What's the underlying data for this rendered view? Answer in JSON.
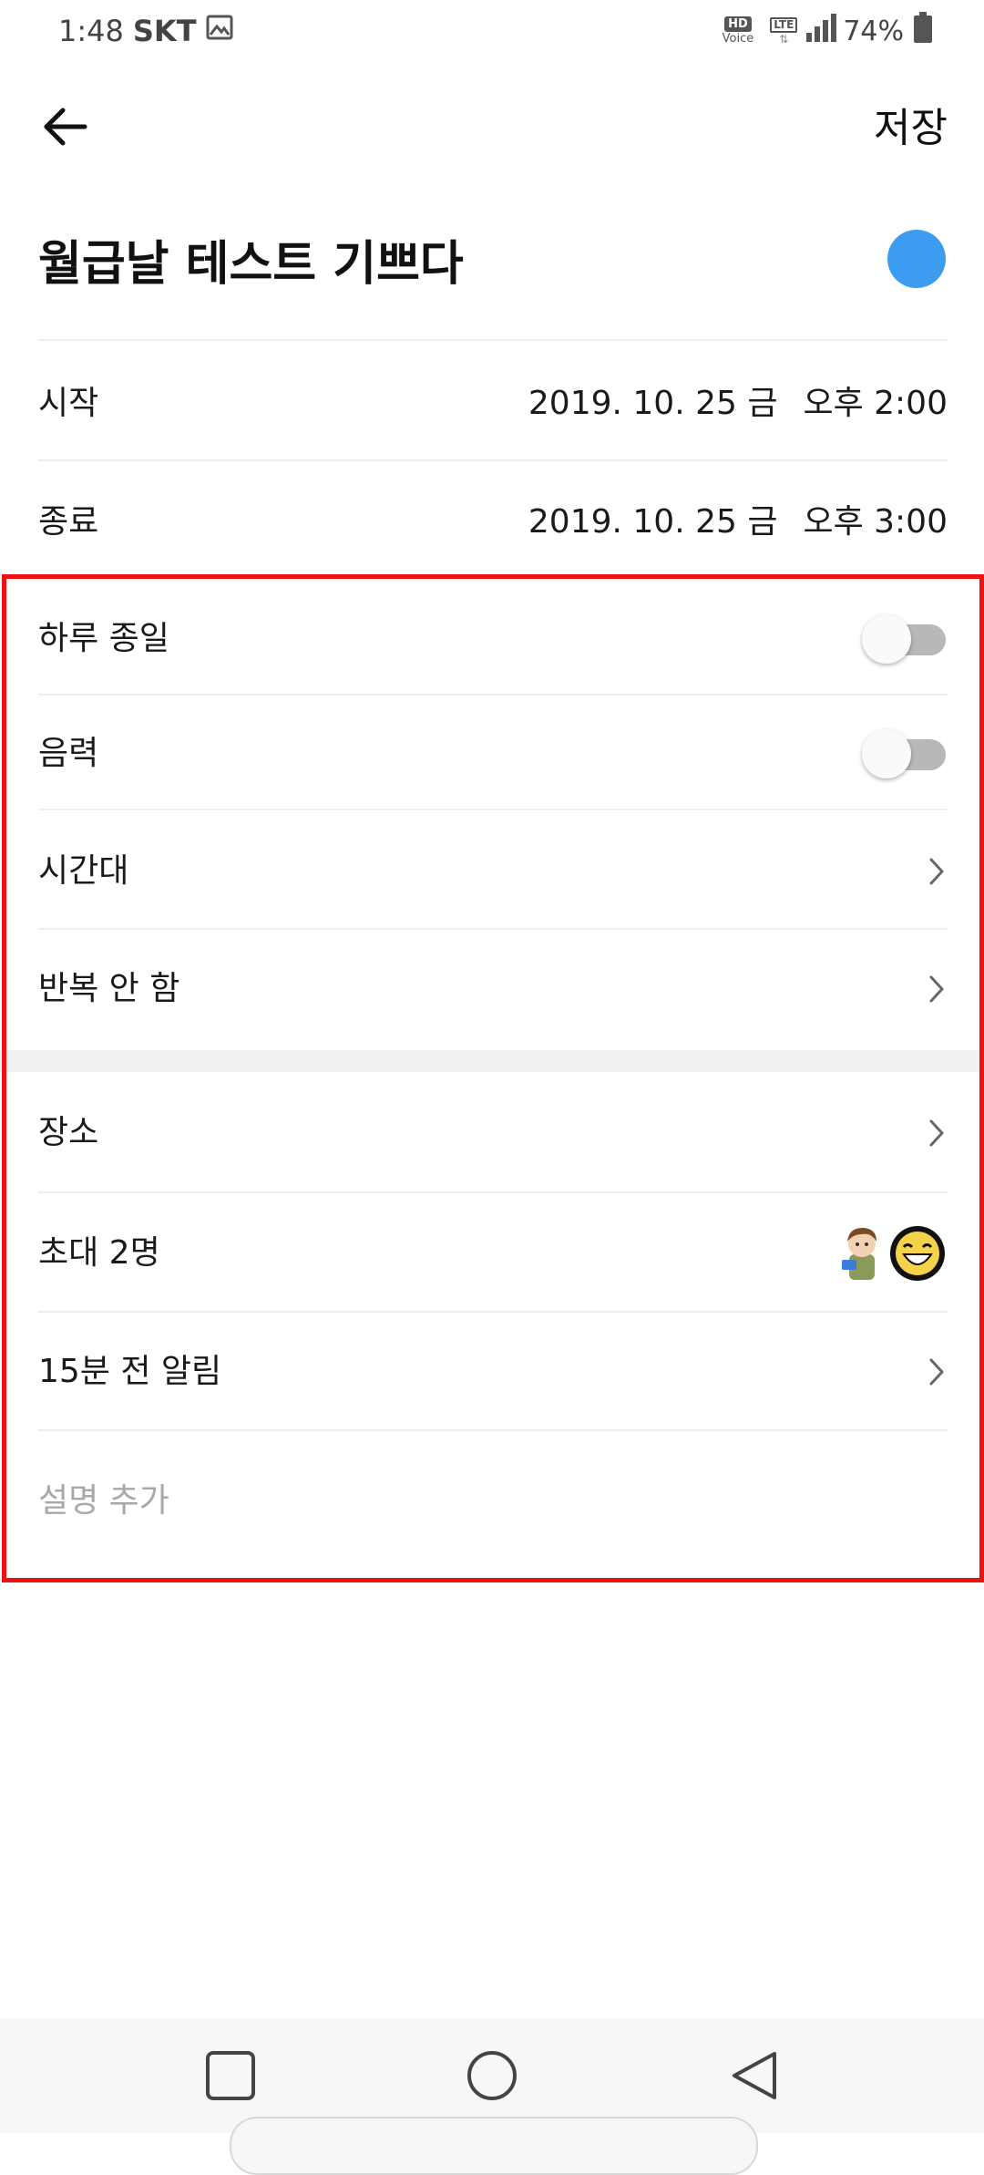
{
  "status_bar": {
    "time": "1:48",
    "carrier": "SKT",
    "hd_label": "HD",
    "voice_label": "Voice",
    "lte_label": "LTE",
    "battery": "74%"
  },
  "header": {
    "save_label": "저장"
  },
  "event": {
    "title": "월급날 테스트 기쁘다",
    "color": "#3b9cf0"
  },
  "schedule": {
    "start": {
      "label": "시작",
      "date": "2019. 10. 25 금",
      "time": "오후 2:00"
    },
    "end": {
      "label": "종료",
      "date": "2019. 10. 25 금",
      "time": "오후 3:00"
    }
  },
  "options": {
    "all_day": {
      "label": "하루 종일",
      "on": false
    },
    "lunar": {
      "label": "음력",
      "on": false
    },
    "timezone": {
      "label": "시간대"
    },
    "repeat": {
      "label": "반복 안 함"
    }
  },
  "details": {
    "location": {
      "label": "장소"
    },
    "invite": {
      "label": "초대 2명",
      "count": 2
    },
    "alarm": {
      "label": "15분 전 알림"
    },
    "description": {
      "placeholder": "설명 추가"
    }
  },
  "colors": {
    "accent": "#3b9cf0",
    "highlight": "#ee1111",
    "toggle_off": "#b8b8b8"
  },
  "icons": {
    "back": "arrow-left",
    "chevron": "chevron-right",
    "nav_recent": "square",
    "nav_home": "circle",
    "nav_back": "triangle-left"
  }
}
